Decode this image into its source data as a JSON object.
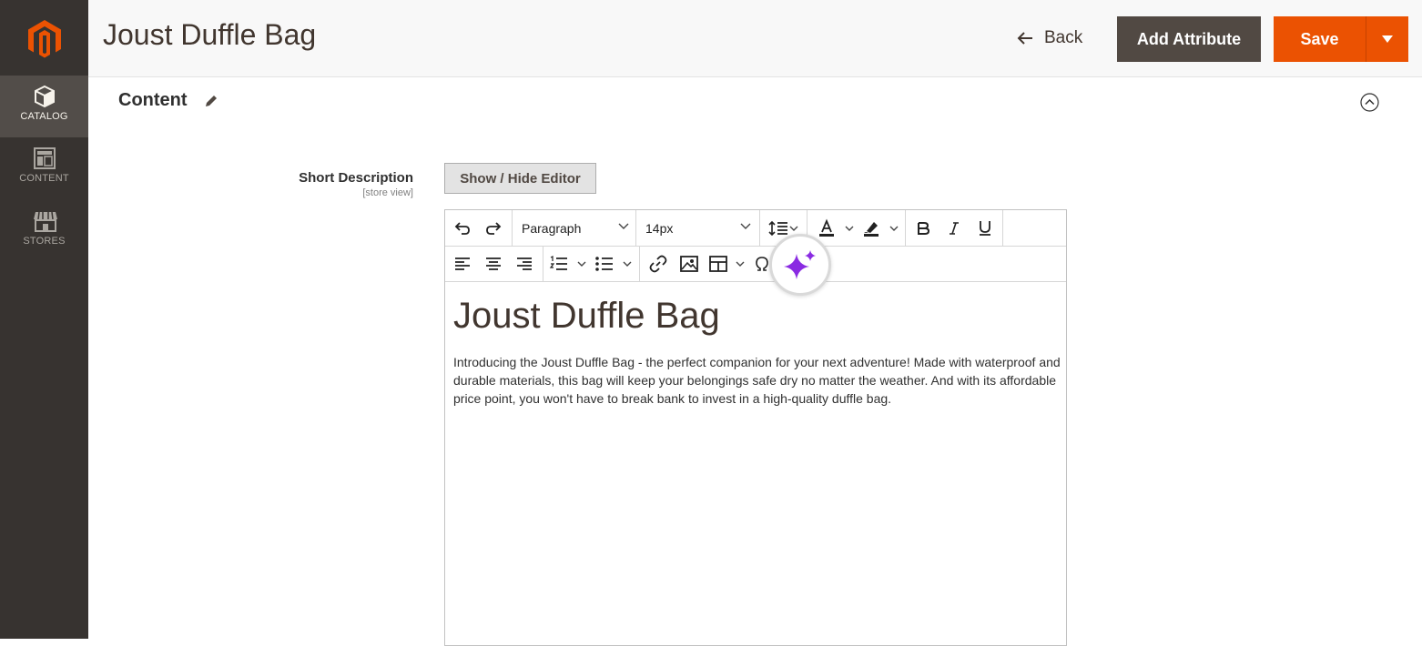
{
  "sidebar": {
    "logo_icon": "magento-logo-icon",
    "items": [
      {
        "label": "CATALOG",
        "icon": "cube-icon",
        "active": true
      },
      {
        "label": "CONTENT",
        "icon": "layout-icon",
        "active": false
      },
      {
        "label": "STORES",
        "icon": "store-icon",
        "active": false
      }
    ]
  },
  "header": {
    "title": "Joust Duffle Bag",
    "back_label": "Back",
    "add_attribute_label": "Add Attribute",
    "save_label": "Save"
  },
  "section": {
    "title": "Content"
  },
  "field": {
    "label": "Short Description",
    "scope": "[store view]",
    "toggle_label": "Show / Hide Editor"
  },
  "editor": {
    "block_format": "Paragraph",
    "font_size": "14px",
    "heading": "Joust Duffle Bag",
    "body": "Introducing the Joust Duffle Bag - the perfect companion for your next adventure! Made with waterproof and durable materials, this bag will keep your belongings safe dry no matter the weather. And with its affordable price point, you won't have to break bank to invest in a high-quality duffle bag."
  },
  "colors": {
    "sidebar_bg": "#373330",
    "accent": "#eb5202",
    "ai_sparkle": "#8a2be2"
  }
}
